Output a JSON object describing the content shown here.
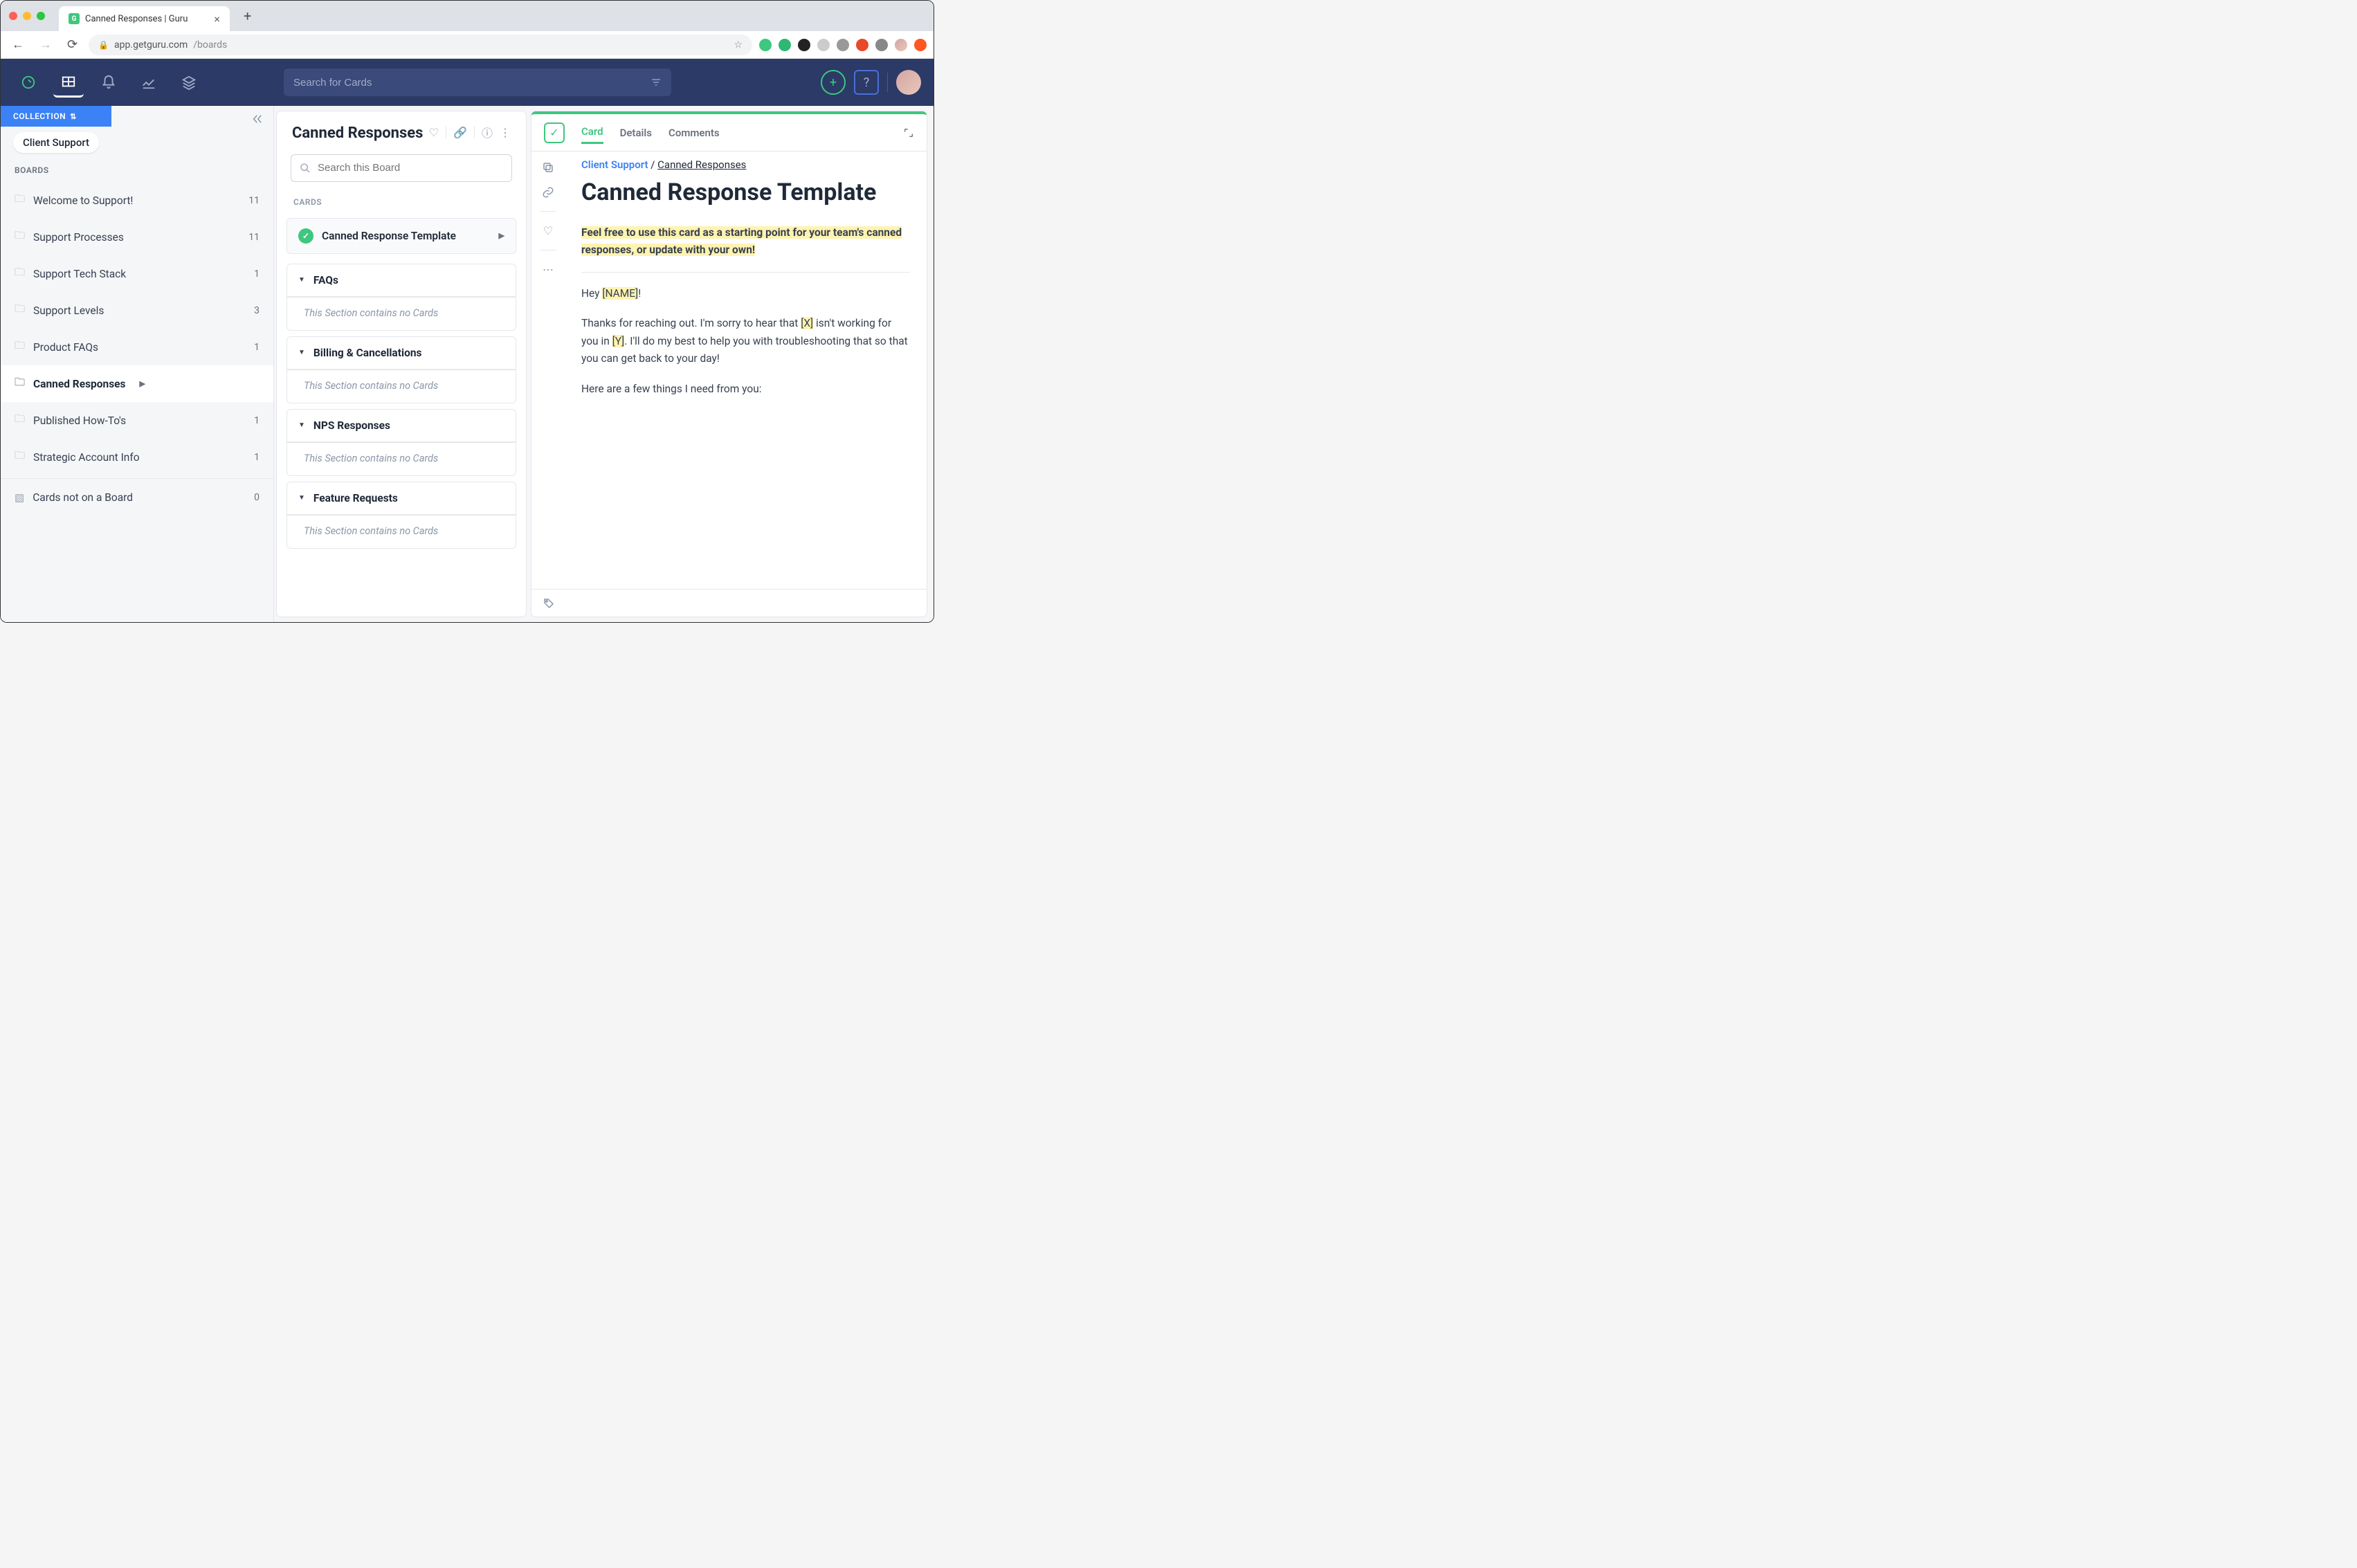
{
  "browser": {
    "tab_title": "Canned Responses | Guru",
    "url_host": "app.getguru.com",
    "url_path": "/boards"
  },
  "header": {
    "search_placeholder": "Search for Cards"
  },
  "sidebar": {
    "collection_label": "COLLECTION",
    "collection_name": "Client Support",
    "boards_label": "BOARDS",
    "boards": [
      {
        "label": "Welcome to Support!",
        "count": "11"
      },
      {
        "label": "Support Processes",
        "count": "11"
      },
      {
        "label": "Support Tech Stack",
        "count": "1"
      },
      {
        "label": "Support Levels",
        "count": "3"
      },
      {
        "label": "Product FAQs",
        "count": "1"
      },
      {
        "label": "Canned Responses",
        "count": ""
      },
      {
        "label": "Published How-To's",
        "count": "1"
      },
      {
        "label": "Strategic Account Info",
        "count": "1"
      }
    ],
    "no_board": {
      "label": "Cards not on a Board",
      "count": "0"
    }
  },
  "board": {
    "title": "Canned Responses",
    "search_placeholder": "Search this Board",
    "cards_label": "CARDS",
    "primary_card": "Canned Response Template",
    "empty_text": "This Section contains no Cards",
    "sections": [
      {
        "title": "FAQs"
      },
      {
        "title": "Billing & Cancellations"
      },
      {
        "title": "NPS Responses"
      },
      {
        "title": "Feature Requests"
      }
    ]
  },
  "card": {
    "tabs": {
      "card": "Card",
      "details": "Details",
      "comments": "Comments"
    },
    "breadcrumb": {
      "collection": "Client Support",
      "sep": " / ",
      "board": "Canned Responses"
    },
    "title": "Canned Response Template",
    "intro": "Feel free to use this card as a starting point for your team's canned responses, or update with your own!",
    "greeting_pre": "Hey ",
    "greeting_name": "[NAME]",
    "greeting_post": "!",
    "p2_a": "Thanks for reaching out. I'm sorry to hear that ",
    "p2_x": "[X]",
    "p2_b": "  isn't working for you in ",
    "p2_y": "[Y]",
    "p2_c": ". I'll do my best to help you with troubleshooting that so that you can get back to your day!",
    "p3": "Here are a few things I need from you:"
  }
}
